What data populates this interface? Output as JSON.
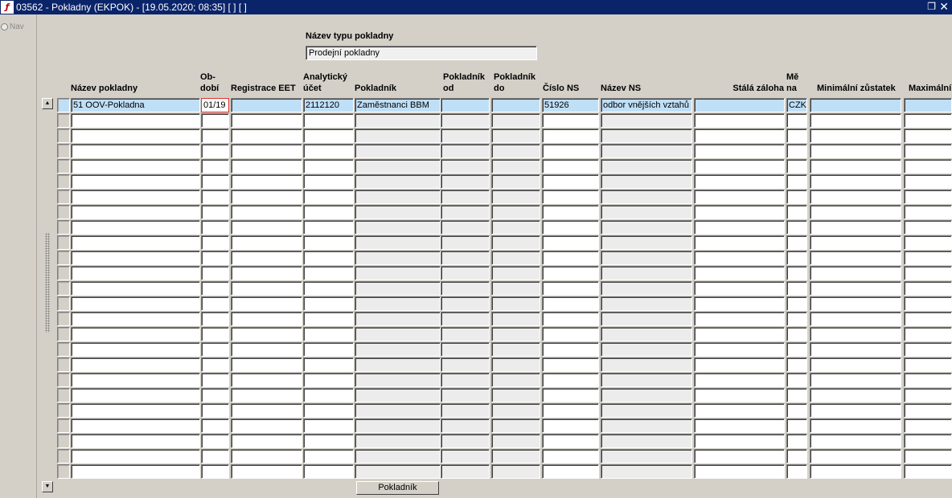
{
  "window": {
    "title": "03562 - Pokladny (EKPOK) - [19.05.2020; 08:35]  [ ]  [ ]",
    "icon_glyph": "ƒ",
    "restore_glyph": "❐",
    "close_glyph": "✕"
  },
  "nav": {
    "label": "Nav"
  },
  "filter": {
    "label": "Název typu pokladny",
    "value": "Prodejní pokladny"
  },
  "columns": {
    "nazev_pokladny": "Název pokladny",
    "obdobi_1": "Ob-",
    "obdobi_2": "dobí",
    "registrace_eet": "Registrace EET",
    "analyticky_1": "Analytický",
    "analyticky_2": "účet",
    "pokladnik": "Pokladník",
    "pokladnik_od_1": "Pokladník",
    "pokladnik_od_2": "od",
    "pokladnik_do_1": "Pokladník",
    "pokladnik_do_2": "do",
    "cislo_ns": "Číslo NS",
    "nazev_ns": "Název NS",
    "stala_zaloha": "Stálá záloha",
    "mena_1": "Mě",
    "mena_2": "na",
    "min_zustatek": "Minimální zůstatek",
    "max_zustatek": "Maximální"
  },
  "rows": [
    {
      "nazev_pokladny": "51 OOV-Pokladna",
      "obdobi": "01/19",
      "registrace_eet": "",
      "analyticky_ucet": "2112120",
      "pokladnik": "Zaměstnanci BBM",
      "pokladnik_od": "",
      "pokladnik_do": "",
      "cislo_ns": "51926",
      "nazev_ns": "odbor vnějších vztahů",
      "stala_zaloha": "",
      "mena": "CZK",
      "min_zustatek": "",
      "max_zustatek": ""
    }
  ],
  "empty_row_count": 24,
  "buttons": {
    "pokladnik": "Pokladník"
  },
  "scroll": {
    "up_glyph": "▲",
    "down_glyph": "▼"
  },
  "colors": {
    "titlebar": "#0a246a",
    "selected_row": "#bfdff7",
    "focus_border": "#e0302a",
    "readonly_cell": "#ececec"
  }
}
